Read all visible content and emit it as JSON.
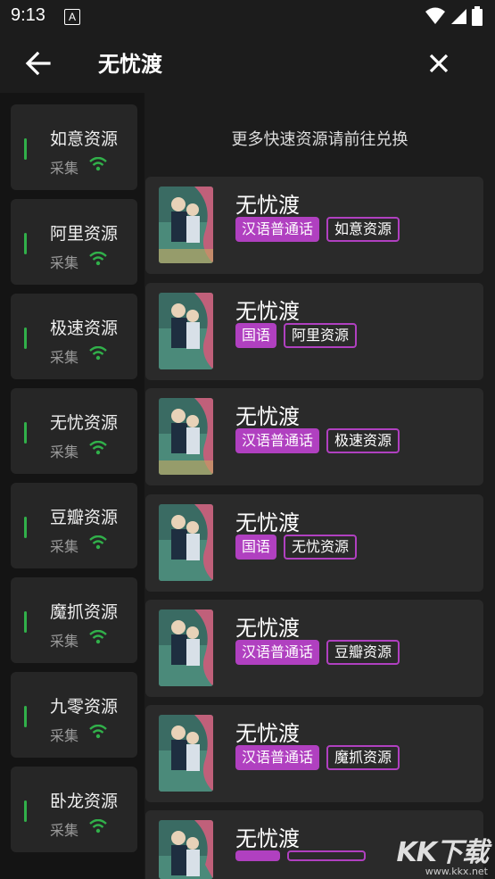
{
  "status": {
    "time": "9:13",
    "badge": "A"
  },
  "appbar": {
    "title": "无忧渡",
    "back_icon": "arrow-left-icon",
    "close_icon": "close-icon"
  },
  "hint": "更多快速资源请前往兑换",
  "sidebar": {
    "items": [
      {
        "label": "如意资源",
        "sub": "采集"
      },
      {
        "label": "阿里资源",
        "sub": "采集"
      },
      {
        "label": "极速资源",
        "sub": "采集"
      },
      {
        "label": "无忧资源",
        "sub": "采集"
      },
      {
        "label": "豆瓣资源",
        "sub": "采集"
      },
      {
        "label": "魔抓资源",
        "sub": "采集"
      },
      {
        "label": "九零资源",
        "sub": "采集"
      },
      {
        "label": "卧龙资源",
        "sub": "采集"
      }
    ]
  },
  "results": [
    {
      "title": "无忧渡",
      "lang": "汉语普通话",
      "source": "如意资源"
    },
    {
      "title": "无忧渡",
      "lang": "国语",
      "source": "阿里资源"
    },
    {
      "title": "无忧渡",
      "lang": "汉语普通话",
      "source": "极速资源"
    },
    {
      "title": "无忧渡",
      "lang": "国语",
      "source": "无忧资源"
    },
    {
      "title": "无忧渡",
      "lang": "汉语普通话",
      "source": "豆瓣资源"
    },
    {
      "title": "无忧渡",
      "lang": "汉语普通话",
      "source": "魔抓资源"
    },
    {
      "title": "无忧渡",
      "lang": "",
      "source": ""
    }
  ],
  "watermark": {
    "main": "KK下载",
    "url": "www.kkx.net"
  },
  "colors": {
    "accent": "#b040c0",
    "signal": "#31b04a"
  }
}
